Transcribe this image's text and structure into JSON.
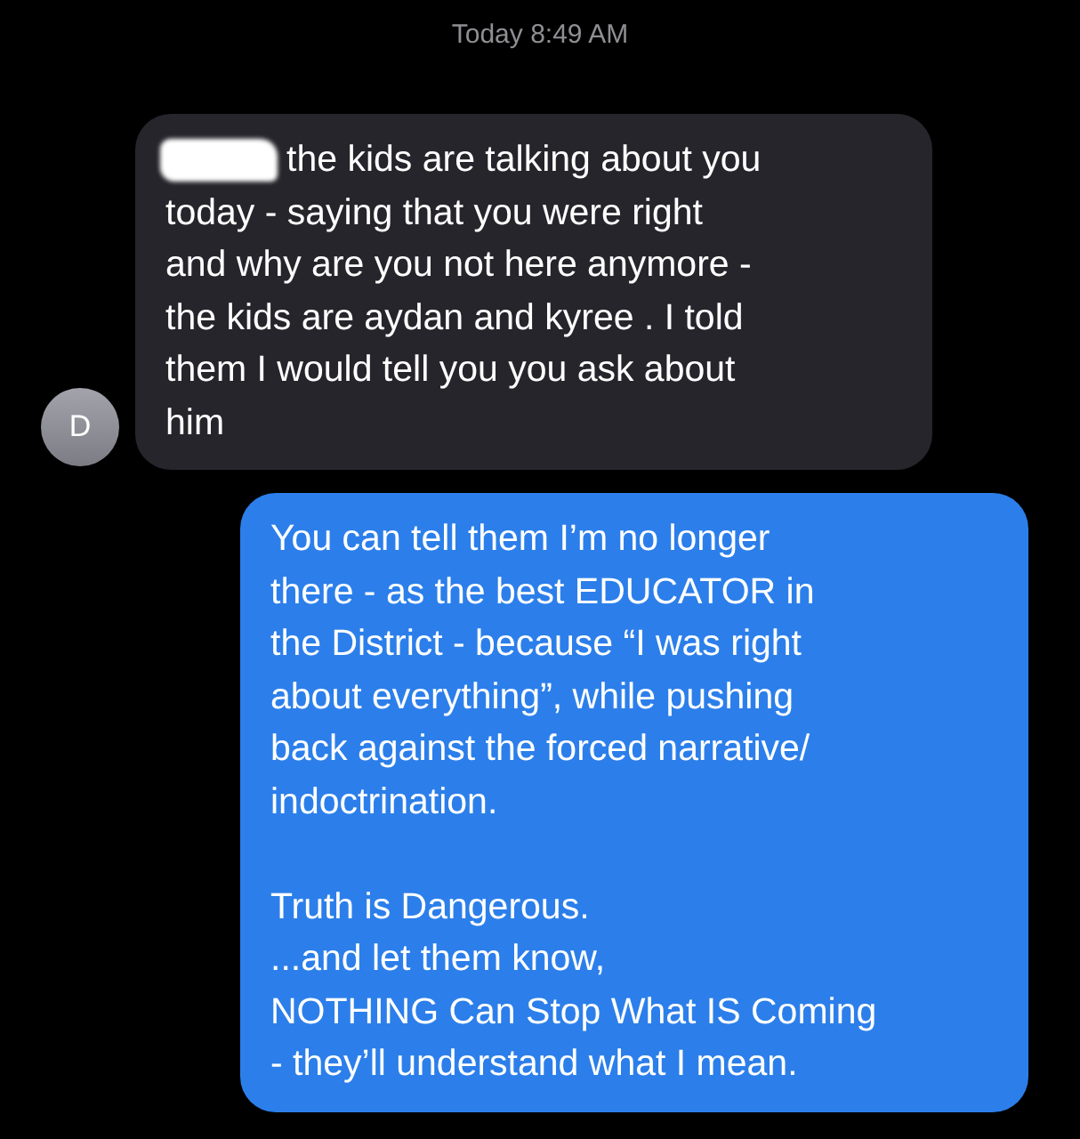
{
  "timestamp": "Today 8:49 AM",
  "messages": [
    {
      "kind": "incoming",
      "avatar": "D",
      "redacted_start": true,
      "paragraphs": [
        "the kids are talking about you\ntoday - saying that you were right\nand why are you not here anymore -\nthe kids are aydan and kyree . I told\nthem I would tell you you ask about\nhim"
      ]
    },
    {
      "kind": "outgoing",
      "redacted_start": false,
      "paragraphs": [
        "You can tell them I’m no longer\nthere - as the best EDUCATOR in\nthe District - because “I was right\nabout everything”, while pushing\nback against the forced narrative/\nindoctrination.",
        "Truth is Dangerous.\n...and let them know,\nNOTHING Can Stop What IS Coming\n- they’ll understand what I mean."
      ]
    }
  ]
}
